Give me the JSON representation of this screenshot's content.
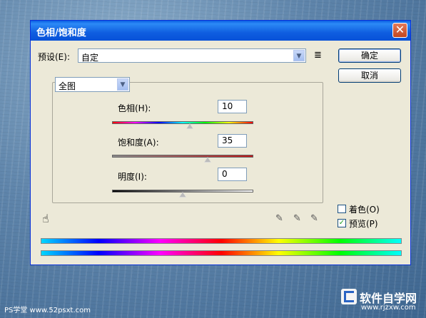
{
  "dialog": {
    "title": "色相/饱和度",
    "close_glyph": "✕"
  },
  "preset": {
    "label": "预设(E):",
    "value": "自定"
  },
  "buttons": {
    "ok": "确定",
    "cancel": "取消"
  },
  "channel": {
    "value": "全图"
  },
  "sliders": [
    {
      "label": "色相(H):",
      "value": "10",
      "position": 0.55
    },
    {
      "label": "饱和度(A):",
      "value": "35",
      "position": 0.675
    },
    {
      "label": "明度(I):",
      "value": "0",
      "position": 0.5
    }
  ],
  "options": {
    "colorize_label": "着色(O)",
    "colorize_checked": false,
    "preview_label": "预览(P)",
    "preview_checked": true
  },
  "watermark": {
    "left": "PS学堂 www.52psxt.com",
    "right_brand": "软件自学网",
    "right_url": "www.rjzxw.com"
  },
  "colors": {
    "title_bar": "#0a5fe4",
    "dialog_bg": "#ece9d8"
  }
}
